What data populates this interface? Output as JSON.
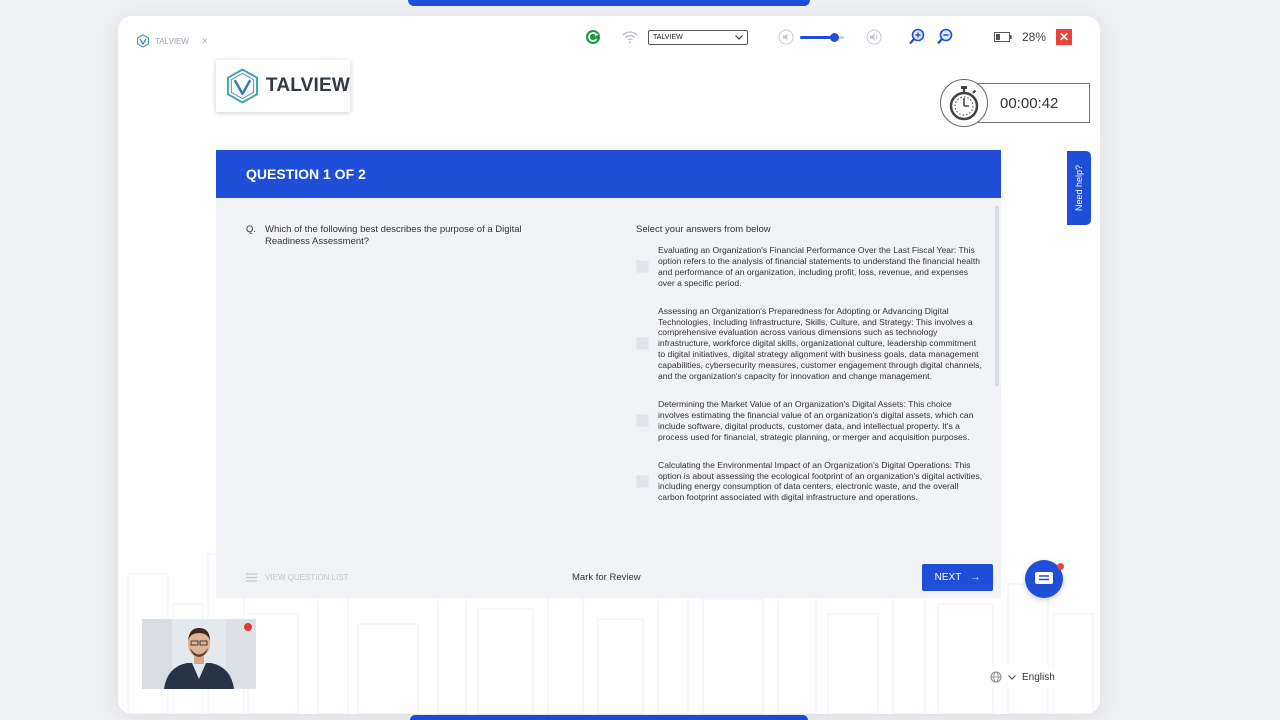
{
  "browser_tab": {
    "title": "TALVIEW",
    "close_glyph": "×"
  },
  "toolbar": {
    "camera_select_value": "TALVIEW",
    "volume_level": 0.8,
    "battery_percent": "28%",
    "close_glyph": "✕"
  },
  "logo": {
    "text": "TALVIEW"
  },
  "timer": {
    "value": "00:00:42"
  },
  "help": {
    "label": "Need help?"
  },
  "question": {
    "header": "QUESTION 1 OF 2",
    "prefix": "Q.",
    "text": "Which of the following best describes the purpose of a Digital Readiness Assessment?",
    "options_title": "Select your answers from below",
    "options": [
      {
        "text": "Evaluating an Organization's Financial Performance Over the Last Fiscal Year: This option refers to the analysis of financial statements to understand the financial health and performance of an organization, including profit, loss, revenue, and expenses over a specific period."
      },
      {
        "text": "Assessing an Organization's Preparedness for Adopting or Advancing Digital Technologies, Including Infrastructure, Skills, Culture, and Strategy: This involves a comprehensive evaluation across various dimensions such as technology infrastructure, workforce digital skills, organizational culture, leadership commitment to digital initiatives, digital strategy alignment with business goals, data management capabilities, cybersecurity measures, customer engagement through digital channels, and the organization's capacity for innovation and change management."
      },
      {
        "text": "Determining the Market Value of an Organization's Digital Assets: This choice involves estimating the financial value of an organization's digital assets, which can include software, digital products, customer data, and intellectual property. It's a process used for financial, strategic planning, or merger and acquisition purposes."
      },
      {
        "text": "Calculating the Environmental Impact of an Organization's Digital Operations: This option is about assessing the ecological footprint of an organization's digital activities, including energy consumption of data centers, electronic waste, and the overall carbon footprint associated with digital infrastructure and operations."
      }
    ]
  },
  "footer": {
    "view_list": "VIEW QUESTION LIST",
    "mark_review": "Mark for Review",
    "next": "NEXT",
    "next_arrow": "→"
  },
  "language": {
    "value": "English"
  },
  "colors": {
    "primary": "#1f4fd8",
    "danger": "#e8443a",
    "card_bg": "#f2f3f6"
  }
}
